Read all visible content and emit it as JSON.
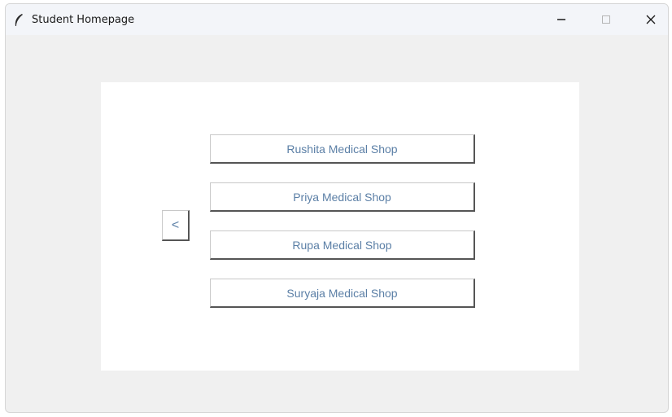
{
  "window": {
    "title": "Student Homepage",
    "minimize_icon": "minimize-icon",
    "maximize_icon": "maximize-icon",
    "close_icon": "close-icon"
  },
  "main": {
    "back_label": "<",
    "shops": [
      {
        "label": "Rushita Medical Shop"
      },
      {
        "label": "Priya Medical Shop"
      },
      {
        "label": "Rupa Medical Shop"
      },
      {
        "label": "Suryaja Medical Shop"
      }
    ]
  },
  "colors": {
    "button_text": "#5b7fa6",
    "window_bg": "#f0f0f0",
    "panel_bg": "#ffffff"
  }
}
